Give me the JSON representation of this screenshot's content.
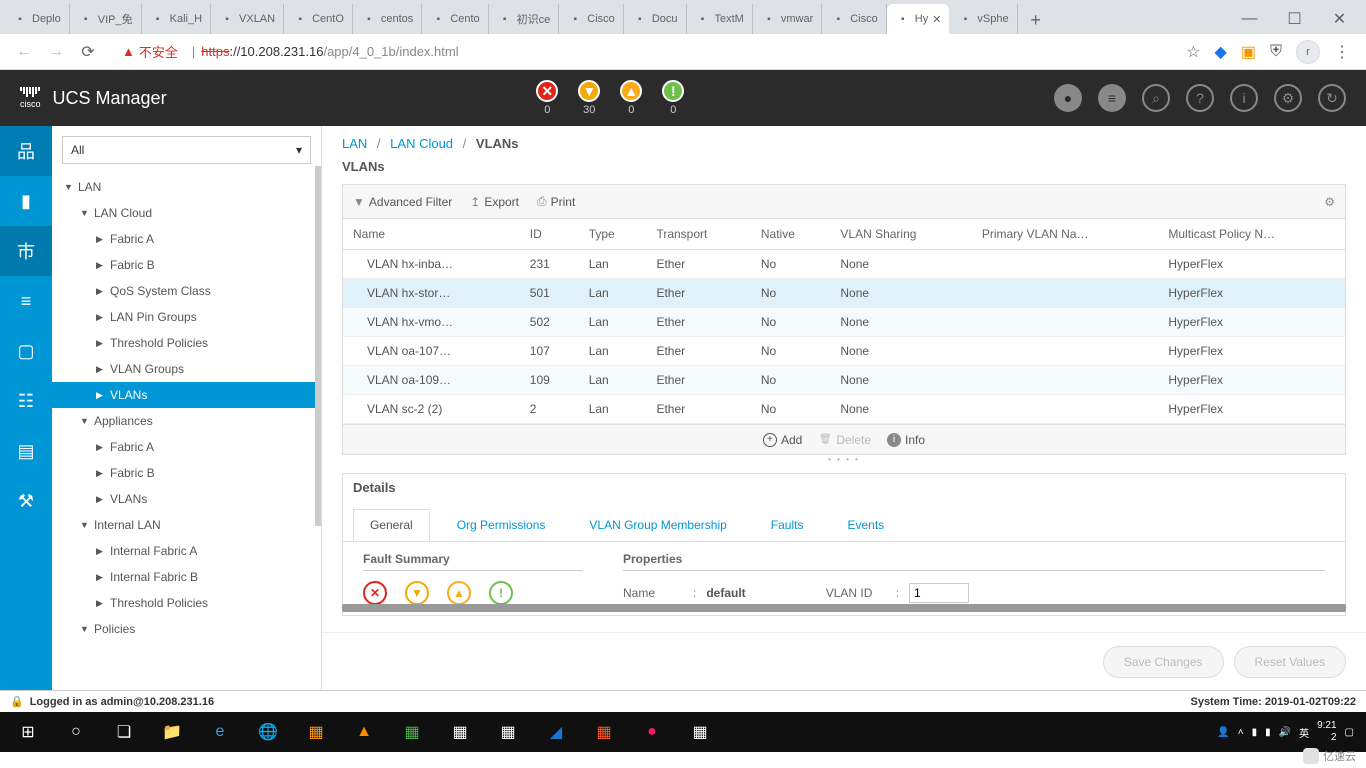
{
  "browser": {
    "tabs": [
      {
        "label": "Deplo",
        "icon": "cisco"
      },
      {
        "label": "VIP_免",
        "icon": "blue"
      },
      {
        "label": "Kali_H",
        "icon": "red-g"
      },
      {
        "label": "VXLAN",
        "icon": "doc"
      },
      {
        "label": "CentO",
        "icon": "linux"
      },
      {
        "label": "centos",
        "icon": "red-c"
      },
      {
        "label": "Cento",
        "icon": "red-c"
      },
      {
        "label": "初识ce",
        "icon": "orange"
      },
      {
        "label": "Cisco",
        "icon": "teal"
      },
      {
        "label": "Docu",
        "icon": "doc"
      },
      {
        "label": "TextM",
        "icon": "purple"
      },
      {
        "label": "vmwar",
        "icon": "vm"
      },
      {
        "label": "Cisco",
        "icon": "cisco"
      },
      {
        "label": "Hy",
        "icon": "blue-tri",
        "active": true
      },
      {
        "label": "vSphe",
        "icon": "green"
      }
    ],
    "url_warning": "不安全",
    "url_scheme": "https",
    "url_host": "://10.208.231.16",
    "url_path": "/app/4_0_1b/index.html",
    "avatar_letter": "r"
  },
  "ucs": {
    "product": "UCS Manager",
    "status": [
      {
        "cls": "sc-red",
        "sym": "✕",
        "count": "0"
      },
      {
        "cls": "sc-orange",
        "sym": "▼",
        "count": "30"
      },
      {
        "cls": "sc-yellow",
        "sym": "▲",
        "count": "0"
      },
      {
        "cls": "sc-green",
        "sym": "!",
        "count": "0"
      }
    ]
  },
  "tree": {
    "dropdown": "All",
    "items": [
      {
        "label": "LAN",
        "level": 0,
        "caret": "▼"
      },
      {
        "label": "LAN Cloud",
        "level": 1,
        "caret": "▼"
      },
      {
        "label": "Fabric A",
        "level": 2,
        "caret": "▶"
      },
      {
        "label": "Fabric B",
        "level": 2,
        "caret": "▶"
      },
      {
        "label": "QoS System Class",
        "level": 2,
        "caret": "▶"
      },
      {
        "label": "LAN Pin Groups",
        "level": 2,
        "caret": "▶"
      },
      {
        "label": "Threshold Policies",
        "level": 2,
        "caret": "▶"
      },
      {
        "label": "VLAN Groups",
        "level": 2,
        "caret": "▶"
      },
      {
        "label": "VLANs",
        "level": 2,
        "caret": "▶",
        "selected": true
      },
      {
        "label": "Appliances",
        "level": 1,
        "caret": "▼"
      },
      {
        "label": "Fabric A",
        "level": 2,
        "caret": "▶"
      },
      {
        "label": "Fabric B",
        "level": 2,
        "caret": "▶"
      },
      {
        "label": "VLANs",
        "level": 2,
        "caret": "▶"
      },
      {
        "label": "Internal LAN",
        "level": 1,
        "caret": "▼"
      },
      {
        "label": "Internal Fabric A",
        "level": 2,
        "caret": "▶"
      },
      {
        "label": "Internal Fabric B",
        "level": 2,
        "caret": "▶"
      },
      {
        "label": "Threshold Policies",
        "level": 2,
        "caret": "▶"
      },
      {
        "label": "Policies",
        "level": 1,
        "caret": "▼"
      }
    ]
  },
  "breadcrumb": {
    "a": "LAN",
    "b": "LAN Cloud",
    "c": "VLANs"
  },
  "page_title": "VLANs",
  "toolbar": {
    "filter": "Advanced Filter",
    "export": "Export",
    "print": "Print"
  },
  "columns": [
    "Name",
    "ID",
    "Type",
    "Transport",
    "Native",
    "VLAN Sharing",
    "Primary VLAN Na…",
    "Multicast Policy N…"
  ],
  "rows": [
    {
      "name": "VLAN hx-inba…",
      "id": "231",
      "type": "Lan",
      "transport": "Ether",
      "native": "No",
      "sharing": "None",
      "primary": "",
      "multicast": "HyperFlex"
    },
    {
      "name": "VLAN hx-stor…",
      "id": "501",
      "type": "Lan",
      "transport": "Ether",
      "native": "No",
      "sharing": "None",
      "primary": "",
      "multicast": "HyperFlex",
      "selected": true
    },
    {
      "name": "VLAN hx-vmo…",
      "id": "502",
      "type": "Lan",
      "transport": "Ether",
      "native": "No",
      "sharing": "None",
      "primary": "",
      "multicast": "HyperFlex",
      "alt": true
    },
    {
      "name": "VLAN oa-107…",
      "id": "107",
      "type": "Lan",
      "transport": "Ether",
      "native": "No",
      "sharing": "None",
      "primary": "",
      "multicast": "HyperFlex"
    },
    {
      "name": "VLAN oa-109…",
      "id": "109",
      "type": "Lan",
      "transport": "Ether",
      "native": "No",
      "sharing": "None",
      "primary": "",
      "multicast": "HyperFlex",
      "alt": true
    },
    {
      "name": "VLAN sc-2 (2)",
      "id": "2",
      "type": "Lan",
      "transport": "Ether",
      "native": "No",
      "sharing": "None",
      "primary": "",
      "multicast": "HyperFlex"
    }
  ],
  "table_actions": {
    "add": "Add",
    "delete": "Delete",
    "info": "Info"
  },
  "details": {
    "title": "Details",
    "tabs": [
      "General",
      "Org Permissions",
      "VLAN Group Membership",
      "Faults",
      "Events"
    ],
    "fault_title": "Fault Summary",
    "props_title": "Properties",
    "name_label": "Name",
    "name_value": "default",
    "vlanid_label": "VLAN ID",
    "vlanid_value": "1"
  },
  "buttons": {
    "save": "Save Changes",
    "reset": "Reset Values"
  },
  "statusbar": {
    "left": "Logged in as admin@10.208.231.16",
    "right": "System Time: 2019-01-02T09:22"
  },
  "tray": {
    "time": "9:21",
    "date": "2",
    "ime": "英"
  },
  "watermark": "亿速云"
}
